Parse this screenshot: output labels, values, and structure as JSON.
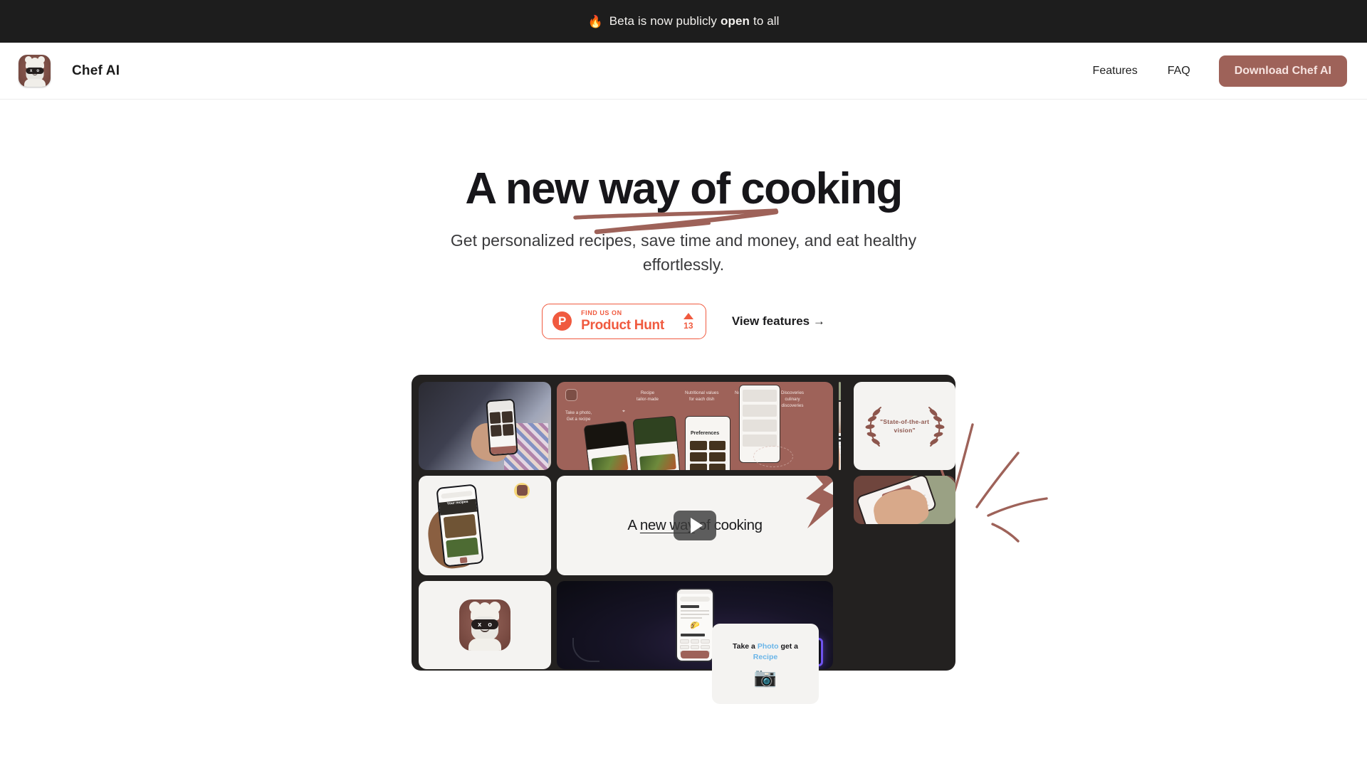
{
  "banner": {
    "icon": "fire-emoji",
    "icon_glyph": "🔥",
    "text_before": "Beta is now publicly",
    "text_bold": "open",
    "text_after": "to all"
  },
  "header": {
    "brand_name": "Chef AI",
    "logo_icon": "chef-robot-app-icon",
    "nav": [
      {
        "label": "Features"
      },
      {
        "label": "FAQ"
      }
    ],
    "download_button": "Download Chef AI"
  },
  "hero": {
    "headline": "A new way of cooking",
    "subtitle": "Get personalized recipes, save time and money, and eat healthy effortlessly.",
    "product_hunt": {
      "logo_letter": "P",
      "kicker": "FIND US ON",
      "name": "Product Hunt",
      "upvote_icon": "upvote-triangle",
      "upvote_count": "13"
    },
    "view_features": "View features →"
  },
  "mosaic": {
    "tile_woman_phone": {
      "name": "woman-holding-phone-photo"
    },
    "tile_feature_board": {
      "logo": "chef-ai-app-icon",
      "labels": [
        "Take a photo,\nGet a recipe",
        "Recipe\ntailor-made",
        "Nutritional values\nfor each dish",
        "No more food\nwaste.",
        "Discoveries\nculinary\ndiscoveries"
      ],
      "phone_screen_title": "Preferences"
    },
    "tile_award": {
      "quote": "\"State-of-the-art vision\"",
      "icon": "laurel-wreath"
    },
    "tile_hand_recipes": {
      "name": "hand-holding-phone-recipes"
    },
    "tile_video": {
      "title_part1": "A ",
      "title_underlined": "new way",
      "title_part2": " of cooking",
      "play_icon": "play-button",
      "decor_icon": "lightning-bolt"
    },
    "tile_hand_maroon": {
      "name": "hand-holding-phone-maroon-background"
    },
    "tile_app_icon": {
      "name": "chef-robot-app-icon"
    },
    "tile_dark_desk": {
      "name": "phone-on-dark-desk-neon"
    },
    "tile_photo_recipe": {
      "line1_a": "Take a ",
      "line1_highlight": "Photo",
      "line1_b": " get a",
      "line2_highlight": "Recipe",
      "icon": "camera-emoji",
      "icon_glyph": "📷"
    },
    "tile_recipe_detail": {
      "name": "hands-holding-phone-recipe-detail"
    }
  },
  "colors": {
    "brand_maroon": "#9e6259",
    "banner_bg": "#1d1d1d",
    "product_hunt_orange": "#f05a3f",
    "mosaic_bg": "#232120",
    "highlight_blue": "#6ab5e8"
  }
}
